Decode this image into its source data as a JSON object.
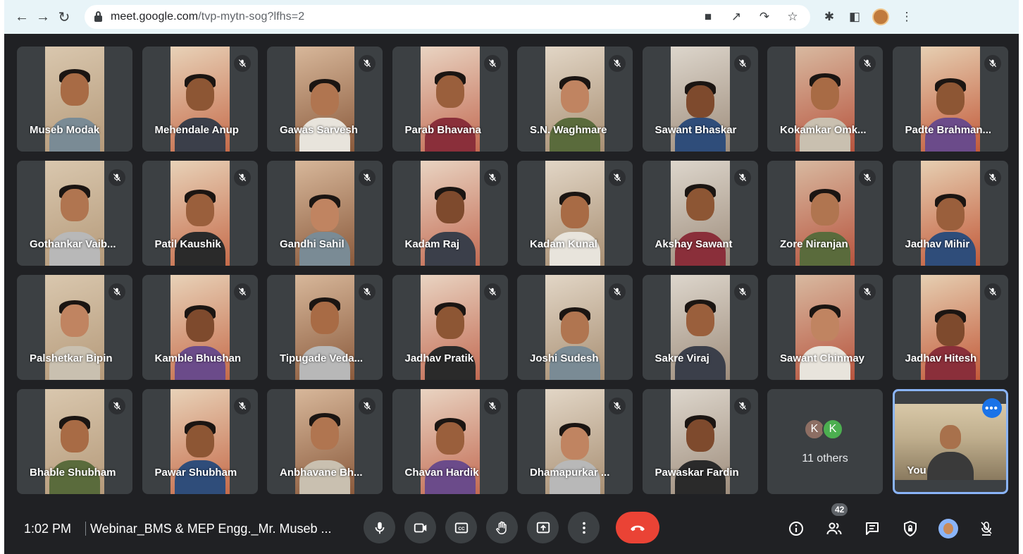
{
  "browser": {
    "url_host": "meet.google.com",
    "url_path": "/tvp-mytn-sog?lfhs=2"
  },
  "participants": [
    {
      "name": "Museb Modak",
      "muted": false
    },
    {
      "name": "Mehendale Anup",
      "muted": true
    },
    {
      "name": "Gawas Sarvesh",
      "muted": true
    },
    {
      "name": "Parab Bhavana",
      "muted": true
    },
    {
      "name": "S.N. Waghmare",
      "muted": true
    },
    {
      "name": "Sawant Bhaskar",
      "muted": true
    },
    {
      "name": "Kokamkar Omk...",
      "muted": true
    },
    {
      "name": "Padte Brahman...",
      "muted": true
    },
    {
      "name": "Gothankar Vaib...",
      "muted": true
    },
    {
      "name": "Patil Kaushik",
      "muted": true
    },
    {
      "name": "Gandhi Sahil",
      "muted": true
    },
    {
      "name": "Kadam Raj",
      "muted": true
    },
    {
      "name": "Kadam Kunal",
      "muted": true
    },
    {
      "name": "Akshay Sawant",
      "muted": true
    },
    {
      "name": "Zore Niranjan",
      "muted": true
    },
    {
      "name": "Jadhav Mihir",
      "muted": true
    },
    {
      "name": "Palshetkar Bipin",
      "muted": true
    },
    {
      "name": "Kamble Bhushan",
      "muted": true
    },
    {
      "name": "Tipugade Veda...",
      "muted": true
    },
    {
      "name": "Jadhav Pratik",
      "muted": true
    },
    {
      "name": "Joshi Sudesh",
      "muted": true
    },
    {
      "name": "Sakre Viraj",
      "muted": true
    },
    {
      "name": "Sawant Chinmay",
      "muted": true
    },
    {
      "name": "Jadhav Hitesh",
      "muted": true
    },
    {
      "name": "Bhable Shubham",
      "muted": true
    },
    {
      "name": "Pawar Shubham",
      "muted": true
    },
    {
      "name": "Anbhavane Bh...",
      "muted": true
    },
    {
      "name": "Chavan Hardik",
      "muted": true
    },
    {
      "name": "Dhamapurkar ...",
      "muted": true
    },
    {
      "name": "Pawaskar Fardin",
      "muted": true
    }
  ],
  "others": {
    "avatar_1": "K",
    "avatar_2": "K",
    "label": "11 others"
  },
  "self": {
    "label": "You"
  },
  "meeting": {
    "time": "1:02 PM",
    "title": "Webinar_BMS & MEP Engg._Mr. Museb ...",
    "participant_count": "42"
  },
  "colors": {
    "background": "#202124",
    "tile": "#3c4043",
    "end_call": "#ea4335",
    "accent": "#8ab4f8"
  }
}
